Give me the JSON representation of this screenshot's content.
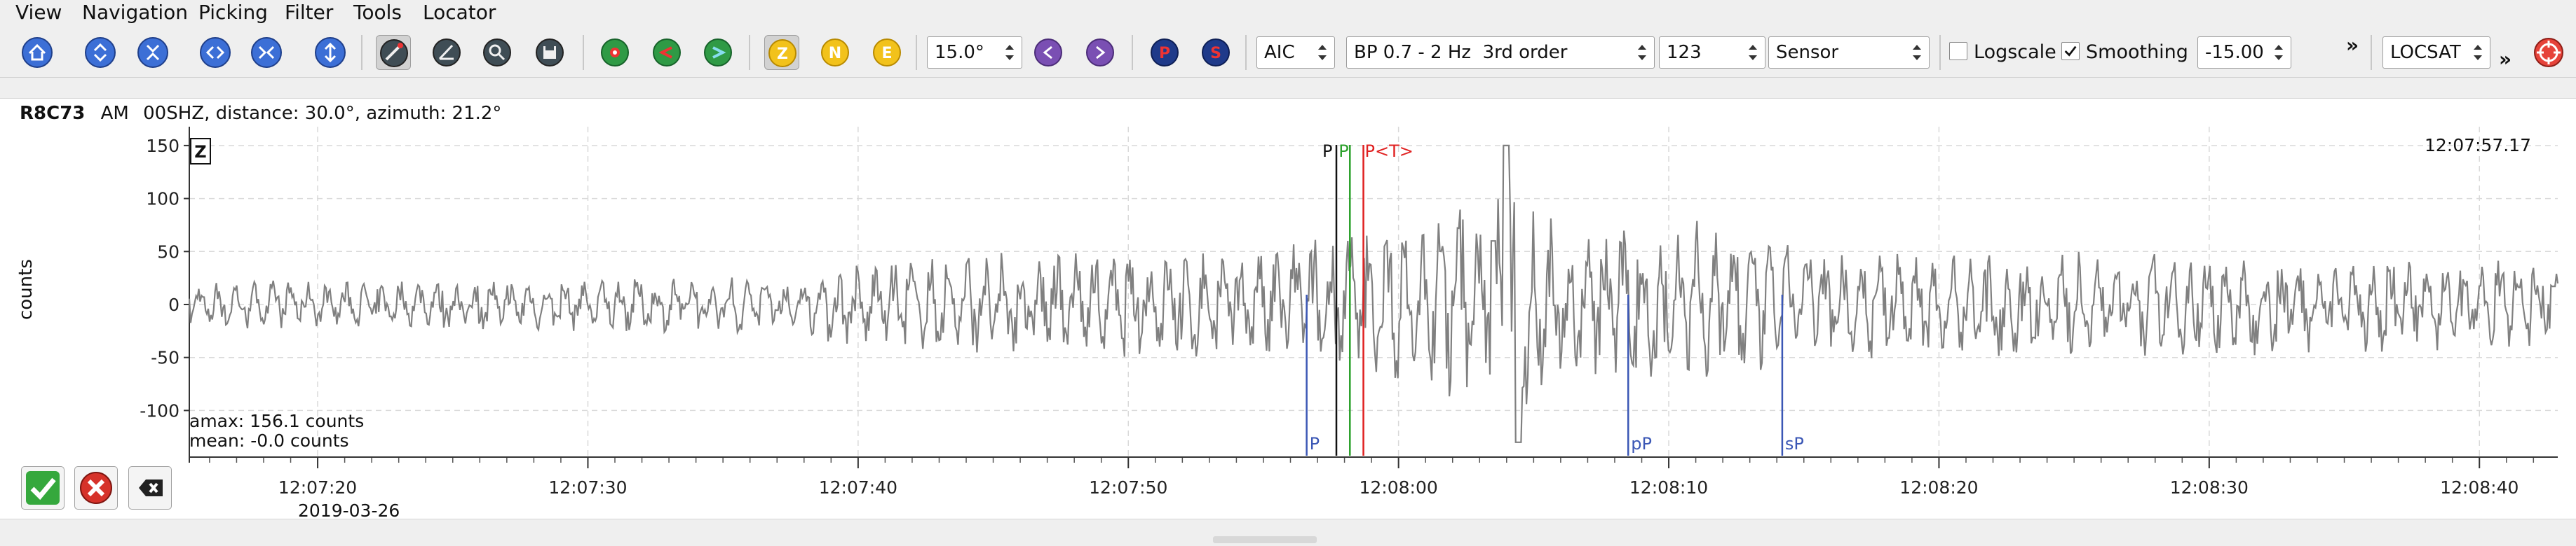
{
  "menubar": {
    "items": [
      "View",
      "Navigation",
      "Picking",
      "Filter",
      "Tools",
      "Locator"
    ]
  },
  "toolbar": {
    "icons": [
      "home-icon",
      "scroll-up-icon",
      "scroll-down-icon",
      "shrink-horizontal-icon",
      "expand-horizontal-icon",
      "expand-vertical-icon",
      "pick-tool-icon",
      "measure-angle-icon",
      "zoom-tool-icon",
      "save-icon",
      "align-origin-icon",
      "align-left-icon",
      "align-right-icon"
    ],
    "components": [
      "Z",
      "N",
      "E"
    ],
    "active_component": "Z",
    "rotation_value": "15.0°",
    "phase_buttons": [
      "P",
      "S"
    ],
    "picker": "AIC",
    "filter": "BP 0.7 - 2 Hz  3rd order",
    "gain_value": "123",
    "units": "Sensor",
    "logscale_label": "Logscale",
    "logscale_checked": false,
    "smoothing_label": "Smoothing",
    "smoothing_checked": true,
    "offset_value": "-15.00",
    "overflow_1": "»",
    "locator": "LOCSAT",
    "overflow_2": "»"
  },
  "trace": {
    "station": "R8C73",
    "network": "AM",
    "channel": "00SHZ",
    "distance_azimuth": ", distance: 30.0°, azimuth: 21.2°",
    "component_badge": "Z",
    "end_time": "12:07:57.17",
    "ylabel": "counts",
    "amax": "amax: 156.1 counts",
    "mean": "mean: -0.0 counts",
    "date": "2019-03-26"
  },
  "colors": {
    "accent_blue": "#3b57b5",
    "pick_red": "#e02020",
    "pick_green": "#2aa02a",
    "trace_gray": "#808080"
  },
  "chart_data": {
    "type": "line",
    "ylabel": "counts",
    "ylim": [
      -135,
      160
    ],
    "yticks": [
      150,
      100,
      50,
      0,
      -50,
      -100
    ],
    "xticks": [
      "12:07:20",
      "12:07:30",
      "12:07:40",
      "12:07:50",
      "12:08:00",
      "12:08:10",
      "12:08:20",
      "12:08:30",
      "12:08:40"
    ],
    "xlim_seconds_from_12_07_00": [
      15.25,
      42.9
    ],
    "grid": true,
    "amax": 156.1,
    "envelope": [
      {
        "t": 15.3,
        "amp": 22
      },
      {
        "t": 17,
        "amp": 25
      },
      {
        "t": 20,
        "amp": 22
      },
      {
        "t": 25,
        "amp": 24
      },
      {
        "t": 28,
        "amp": 25
      },
      {
        "t": 31,
        "amp": 27
      },
      {
        "t": 36,
        "amp": 28
      },
      {
        "t": 40,
        "amp": 40
      },
      {
        "t": 42,
        "amp": 47
      },
      {
        "t": 45,
        "amp": 50
      },
      {
        "t": 50,
        "amp": 52
      },
      {
        "t": 55,
        "amp": 55
      },
      {
        "t": 58,
        "amp": 70
      },
      {
        "t": 60,
        "amp": 75
      },
      {
        "t": 62,
        "amp": 95
      },
      {
        "t": 64,
        "amp": 150
      },
      {
        "t": 66,
        "amp": 70
      },
      {
        "t": 69,
        "amp": 80
      },
      {
        "t": 71,
        "amp": 85
      },
      {
        "t": 74,
        "amp": 60
      },
      {
        "t": 80,
        "amp": 50
      },
      {
        "t": 90,
        "amp": 50
      },
      {
        "t": 100,
        "amp": 45
      },
      {
        "t": 102.9,
        "amp": 40
      }
    ],
    "picks_top": [
      {
        "label": "P",
        "t": 57.7,
        "color": "#111111"
      },
      {
        "label": "P",
        "t": 58.2,
        "color": "#2aa02a"
      },
      {
        "label": "P<T>",
        "t": 58.7,
        "color": "#e02020"
      }
    ],
    "picks_theoretical": [
      {
        "label": "P",
        "t": 56.6
      },
      {
        "label": "pP",
        "t": 68.5
      },
      {
        "label": "sP",
        "t": 74.2
      }
    ]
  },
  "actions": {
    "accept": "accept-icon",
    "reject": "reject-icon",
    "delete": "delete-icon"
  }
}
